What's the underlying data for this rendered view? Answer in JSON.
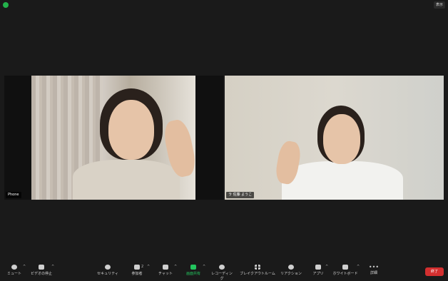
{
  "window": {
    "view_label": "表示"
  },
  "participants": [
    {
      "name": "Phone"
    },
    {
      "name": "ラ 佐藤 ようこ"
    }
  ],
  "toolbar": {
    "mute": "ミュート",
    "video": "ビデオの停止",
    "security": "セキュリティ",
    "participants": "参加者",
    "participants_count": "2",
    "chat": "チャット",
    "share": "画面共有",
    "record": "レコーディング",
    "breakout": "ブレイクアウトルーム",
    "reactions": "リアクション",
    "apps": "アプリ",
    "whiteboard": "ホワイトボード",
    "more": "詳細",
    "end": "終了"
  },
  "colors": {
    "accent_green": "#23c55e",
    "end_red": "#d32f2f",
    "shield_green": "#23b24b"
  }
}
